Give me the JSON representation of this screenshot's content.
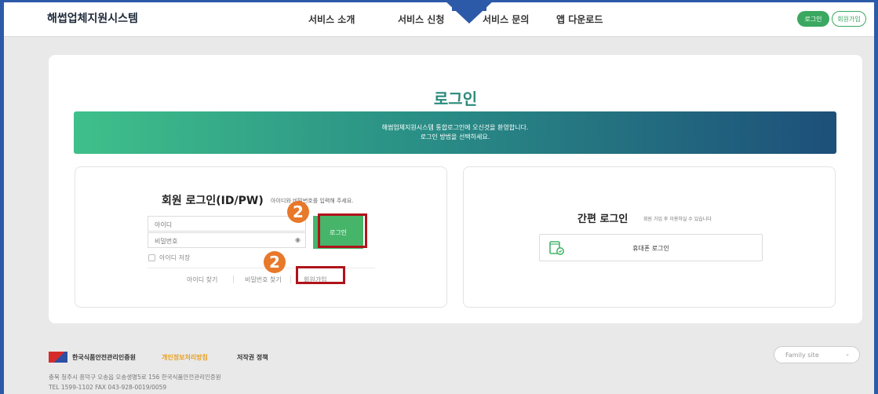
{
  "header": {
    "logo": "해썹업체지원시스템",
    "nav": [
      "서비스 소개",
      "서비스 신청",
      "서비스 문의",
      "앱 다운로드"
    ],
    "login_button": "로그인",
    "join_button": "회원가입"
  },
  "main": {
    "title": "로그인",
    "banner_line1": "해썹업체지원시스템 통합로그인에 오신것을 환영합니다.",
    "banner_line2": "로그인 방법을 선택하세요."
  },
  "member_login": {
    "title": "회원 로그인(ID/PW)",
    "hint": "아이디와 비밀번호를 입력해 주세요.",
    "id_placeholder": "아이디",
    "pw_placeholder": "비밀번호",
    "login_button": "로그인",
    "save_id": "아이디 저장",
    "find_id": "아이디 찾기",
    "find_pw": "비밀번호 찾기",
    "join": "회원가입"
  },
  "simple_login": {
    "title": "간편 로그인",
    "hint": "회원 가입 후 이용하실 수 있습니다",
    "phone_login": "휴대폰 로그인"
  },
  "annotations": {
    "step_badge": "2",
    "highlight_color": "#b0131b",
    "badge_color": "#e8782a"
  },
  "footer": {
    "org": "한국식품안전관리인증원",
    "privacy": "개인정보처리방침",
    "copyright": "저작권 정책",
    "family_site": "Family site",
    "address": "충북 청주시 흥덕구 오송읍 오송생명5로 156 한국식품안전관리인증원",
    "tel": "TEL 1599-1102 FAX 043-928-0019/0059"
  },
  "colors": {
    "accent_green": "#46b56a",
    "title_teal": "#2a8a7a",
    "frame_blue": "#2d5aa8"
  }
}
